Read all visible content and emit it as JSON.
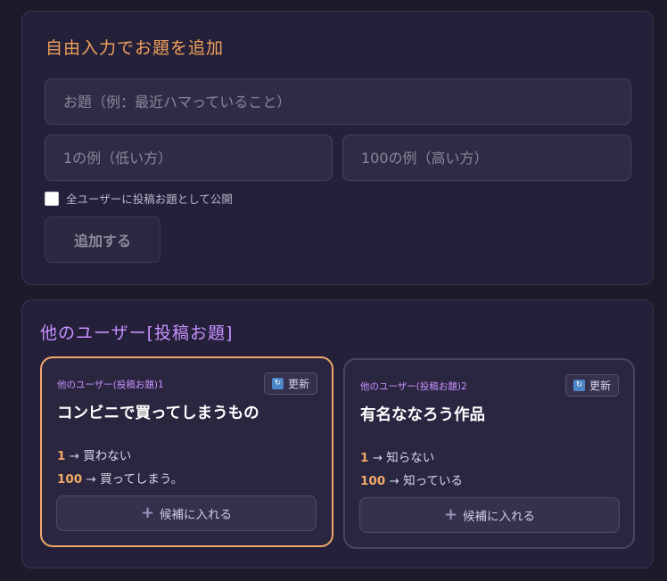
{
  "custom_topic": {
    "title": "自由入力でお題を追加",
    "topic_placeholder": "お題（例：最近ハマっていること）",
    "low_placeholder": "1の例（低い方）",
    "high_placeholder": "100の例（高い方）",
    "publish_label": "全ユーザーに投稿お題として公開",
    "publish_checked": false,
    "add_label": "追加する"
  },
  "other_users": {
    "title": "他のユーザー[投稿お題]",
    "refresh_label": "更新",
    "add_candidate_label": "候補に入れる",
    "cards": [
      {
        "label": "他のユーザー(投稿お題)1",
        "title": "コンビニで買ってしまうもの",
        "low_num": "1",
        "low_text": "→ 買わない",
        "high_num": "100",
        "high_text": "→ 買ってしまう。"
      },
      {
        "label": "他のユーザー(投稿お題)2",
        "title": "有名ななろう作品",
        "low_num": "1",
        "low_text": "→ 知らない",
        "high_num": "100",
        "high_text": "→ 知っている"
      }
    ]
  }
}
